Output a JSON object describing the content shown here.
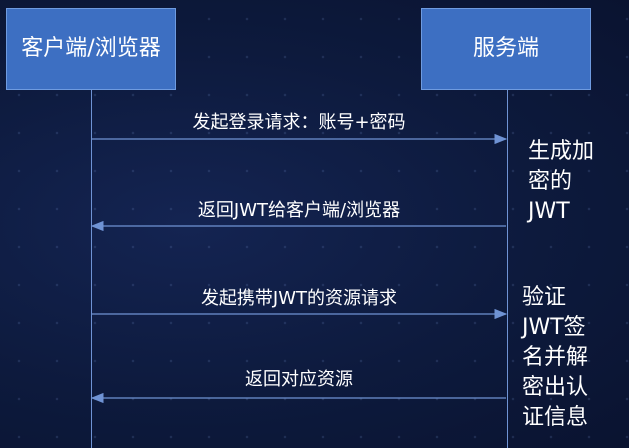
{
  "participants": {
    "client": "客户端/浏览器",
    "server": "服务端"
  },
  "messages": [
    {
      "label": "发起登录请求：账号+密码",
      "direction": "right"
    },
    {
      "label": "返回JWT给客户端/浏览器",
      "direction": "left"
    },
    {
      "label": "发起携带JWT的资源请求",
      "direction": "right"
    },
    {
      "label": "返回对应资源",
      "direction": "left"
    }
  ],
  "notes": {
    "generate": "生成加\n密的\nJWT",
    "verify": "验证\nJWT签\n名并解\n密出认\n证信息"
  },
  "colors": {
    "participant_fill": "#3d6fc2",
    "line": "#6f93d4",
    "text": "#ffffff"
  }
}
